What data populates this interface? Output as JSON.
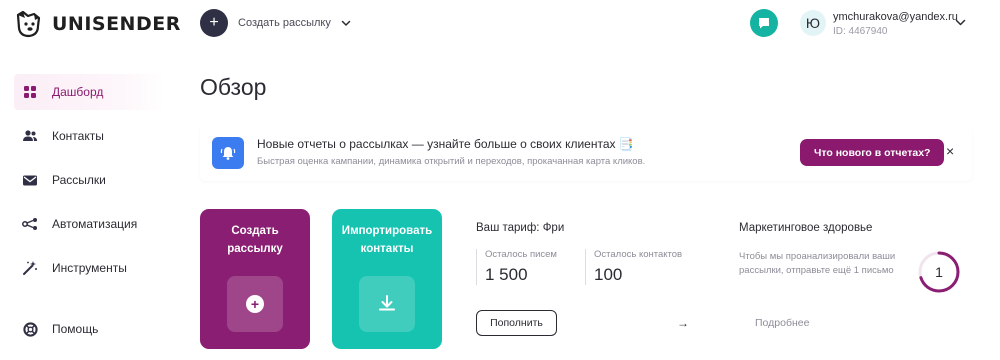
{
  "brand": {
    "name": "UNISENDER",
    "logo_icon": "dog-logo-icon"
  },
  "header": {
    "create_label": "Создать рассылку",
    "avatar_initial": "Ю",
    "user_email": "ymchurakova@yandex.ru",
    "user_id": "ID: 4467940",
    "chat_icon": "chat-bubble-icon"
  },
  "sidebar": {
    "items": [
      {
        "label": "Дашборд",
        "icon": "dashboard-icon",
        "active": true
      },
      {
        "label": "Контакты",
        "icon": "users-icon",
        "active": false
      },
      {
        "label": "Рассылки",
        "icon": "envelope-icon",
        "active": false
      },
      {
        "label": "Автоматизация",
        "icon": "automation-icon",
        "active": false
      },
      {
        "label": "Инструменты",
        "icon": "magic-wand-icon",
        "active": false
      }
    ],
    "help_label": "Помощь"
  },
  "main": {
    "title": "Обзор",
    "banner": {
      "title": "Новые отчеты о рассылках — узнайте больше о своих клиентах 📑",
      "subtitle": "Быстрая оценка кампании, динамика открытий и переходов, прокачанная карта кликов.",
      "cta": "Что нового в отчетах?",
      "close": "×"
    },
    "cards": {
      "create_label": "Создать рассылку",
      "import_label": "Импортировать контакты"
    },
    "tariff": {
      "title": "Ваш тариф: Фри",
      "letters_label": "Осталось писем",
      "letters_value": "1 500",
      "contacts_label": "Осталось контактов",
      "contacts_value": "100",
      "topup_label": "Пополнить",
      "arrow": "→"
    },
    "health": {
      "title": "Маркетинговое здоровье",
      "text": "Чтобы мы проанализировали ваши рассылки, отправьте ещё 1 письмо",
      "ring_value": "1",
      "ring_progress": 0.7,
      "more_label": "Подробнее"
    }
  },
  "colors": {
    "accent_purple": "#8a1e72",
    "accent_teal": "#16c2b0",
    "banner_blue": "#3b7df0",
    "dark": "#2f3045"
  }
}
